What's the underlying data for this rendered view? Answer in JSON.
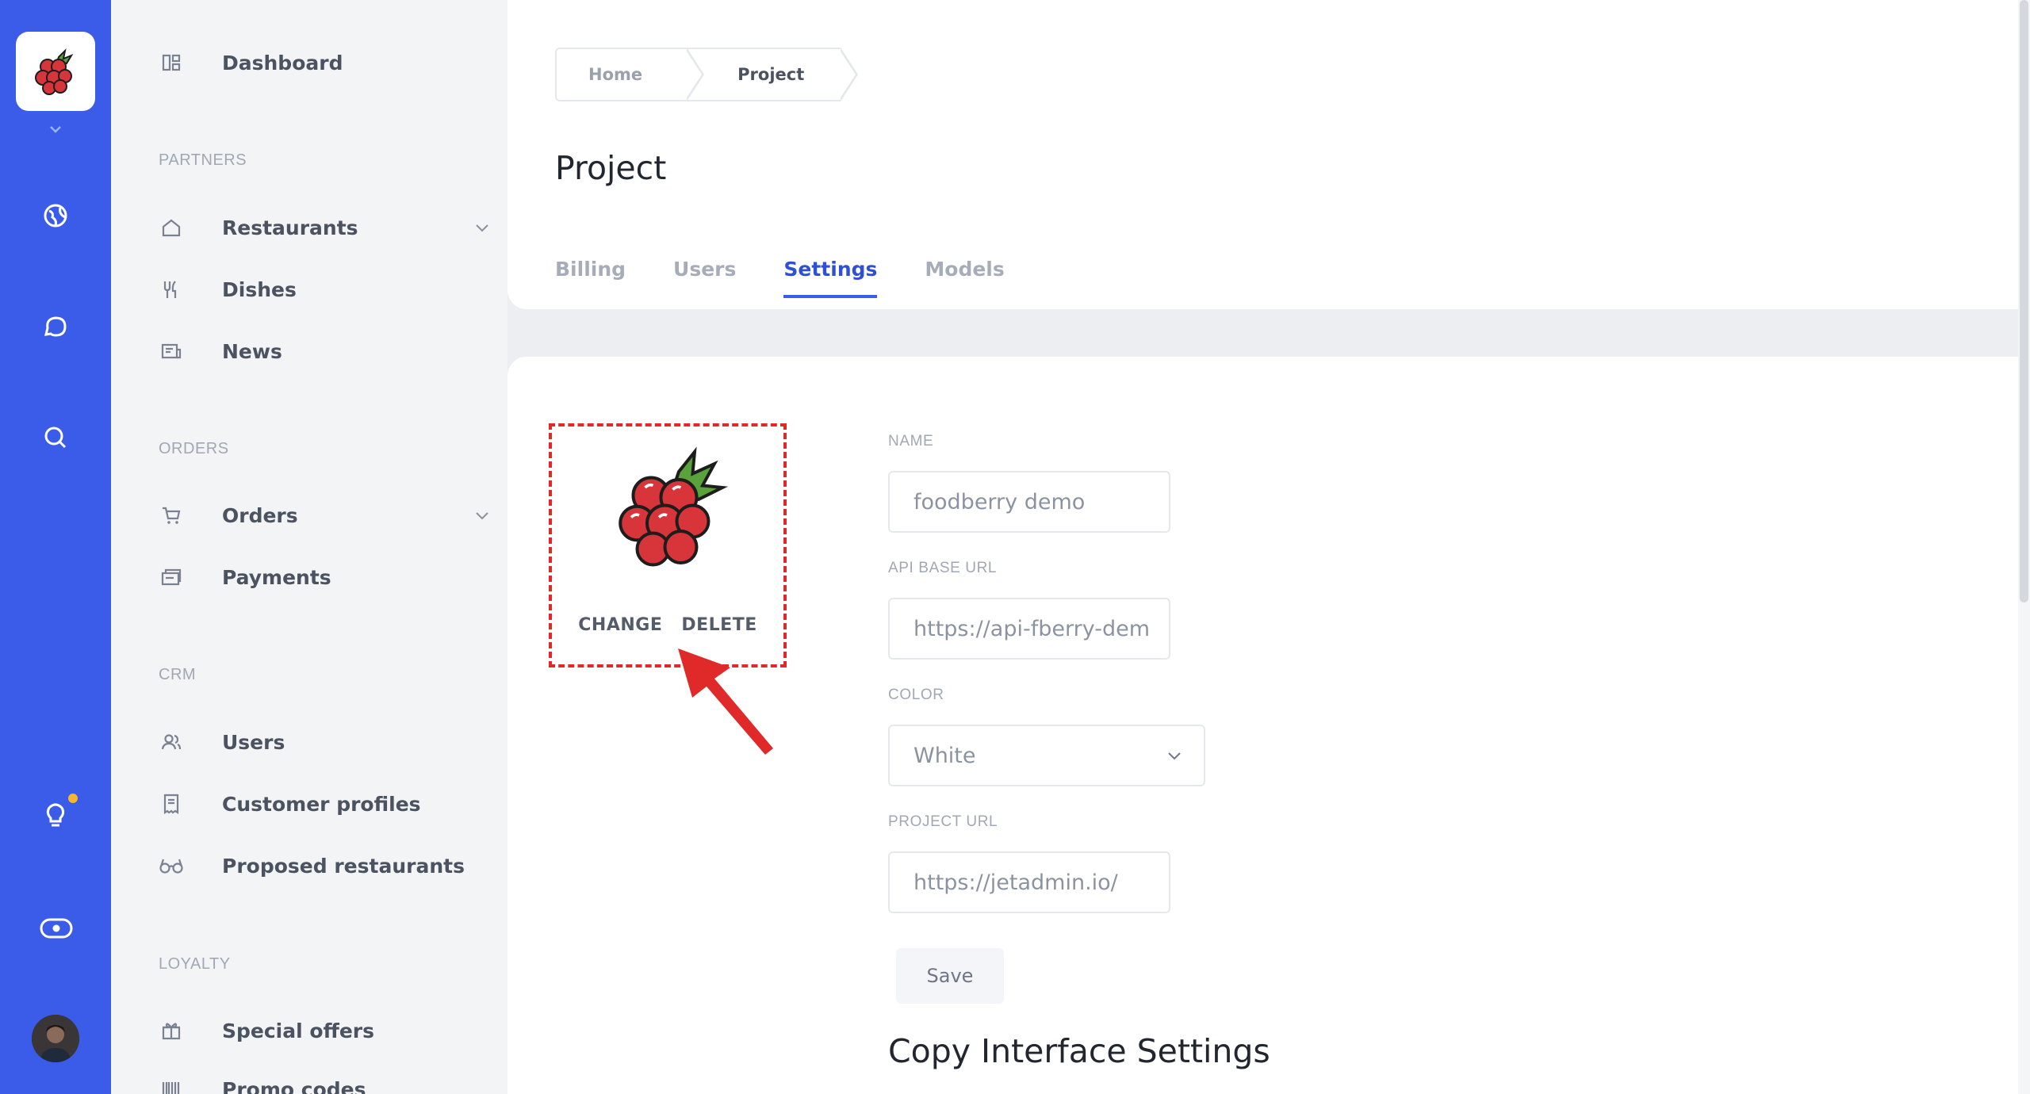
{
  "rail": {
    "icons": [
      "raspberry-logo",
      "globe-icon",
      "chat-icon",
      "search-icon",
      "lightbulb-icon",
      "toggle-icon"
    ],
    "notification_color": "#f5b829"
  },
  "sidebar": {
    "sections": {
      "partners": "PARTNERS",
      "orders": "ORDERS",
      "crm": "CRM",
      "loyalty": "LOYALTY"
    },
    "items": {
      "dashboard": "Dashboard",
      "restaurants": "Restaurants",
      "dishes": "Dishes",
      "news": "News",
      "orders": "Orders",
      "payments": "Payments",
      "users": "Users",
      "customer_profiles": "Customer profiles",
      "proposed_restaurants": "Proposed restaurants",
      "special_offers": "Special offers",
      "promo_codes": "Promo codes"
    }
  },
  "breadcrumb": {
    "home": "Home",
    "current": "Project"
  },
  "page": {
    "title": "Project"
  },
  "tabs": [
    {
      "label": "Billing",
      "active": false
    },
    {
      "label": "Users",
      "active": false
    },
    {
      "label": "Settings",
      "active": true
    },
    {
      "label": "Models",
      "active": false
    }
  ],
  "logo_editor": {
    "change_label": "CHANGE",
    "delete_label": "DELETE"
  },
  "form": {
    "name_label": "NAME",
    "name_value": "foodberry demo",
    "api_label": "API BASE URL",
    "api_value": "https://api-fberry-dem",
    "color_label": "COLOR",
    "color_value": "White",
    "project_url_label": "PROJECT URL",
    "project_url_value": "https://jetadmin.io/",
    "save_label": "Save"
  },
  "copy_section": {
    "title": "Copy Interface Settings"
  },
  "colors": {
    "accent": "#3b5ce9",
    "highlight": "#e02a2a"
  }
}
